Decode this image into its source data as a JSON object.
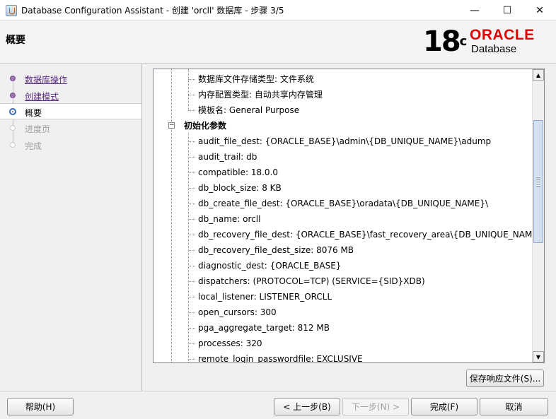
{
  "window": {
    "title": "Database Configuration Assistant - 创建 'orcll' 数据库 - 步骤 3/5",
    "minimize": "—",
    "maximize": "☐",
    "close": "✕"
  },
  "header": {
    "title": "概要",
    "logo_version": "18",
    "logo_sup": "c",
    "logo_brand": "ORACLE",
    "logo_product": "Database"
  },
  "nav": {
    "items": [
      {
        "label": "数据库操作",
        "state": "done"
      },
      {
        "label": "创建模式",
        "state": "done"
      },
      {
        "label": "概要",
        "state": "current"
      },
      {
        "label": "进度页",
        "state": "todo"
      },
      {
        "label": "完成",
        "state": "todo"
      }
    ]
  },
  "tree": {
    "storage_rows": [
      "数据库文件存储类型: 文件系统",
      "内存配置类型: 自动共享内存管理",
      "模板名: General Purpose"
    ],
    "group_label": "初始化参数",
    "collapse_glyph": "−",
    "params": [
      "audit_file_dest: {ORACLE_BASE}\\admin\\{DB_UNIQUE_NAME}\\adump",
      "audit_trail: db",
      "compatible: 18.0.0",
      "db_block_size: 8 KB",
      "db_create_file_dest: {ORACLE_BASE}\\oradata\\{DB_UNIQUE_NAME}\\",
      "db_name: orcll",
      "db_recovery_file_dest: {ORACLE_BASE}\\fast_recovery_area\\{DB_UNIQUE_NAME}",
      "db_recovery_file_dest_size: 8076 MB",
      "diagnostic_dest: {ORACLE_BASE}",
      "dispatchers: (PROTOCOL=TCP) (SERVICE={SID}XDB)",
      "local_listener: LISTENER_ORCLL",
      "open_cursors: 300",
      "pga_aggregate_target: 812 MB",
      "processes: 320",
      "remote_login_passwordfile: EXCLUSIVE"
    ]
  },
  "scrollbar": {
    "up": "▲",
    "down": "▼"
  },
  "buttons": {
    "save_response": "保存响应文件(S)...",
    "help": "帮助(H)",
    "back": "< 上一步(B)",
    "next": "下一步(N) >",
    "finish": "完成(F)",
    "cancel": "取消"
  }
}
